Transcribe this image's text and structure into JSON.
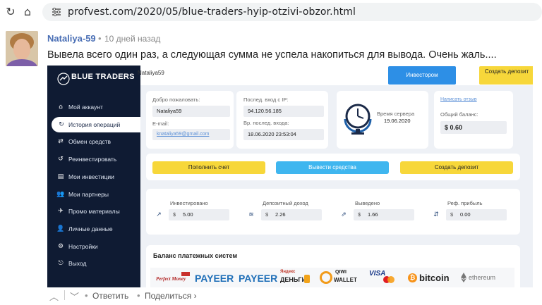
{
  "browser": {
    "url": "profvest.com/2020/05/blue-traders-hyip-otzivi-obzor.html"
  },
  "comment": {
    "author": "Nataliya-59",
    "separator": "•",
    "time": "10 дней назад",
    "text": "Вывела всего один раз, а следующая сумма не успела накопиться для вывода. Очень жаль....",
    "reply_label": "Ответить",
    "share_label": "Поделиться ›"
  },
  "screenshot": {
    "logo": "BLUE TRADERS",
    "header_user": "Nataliya59",
    "invest_button": "Инвестором",
    "create_deposit_button": "Создать депозит",
    "sidebar": [
      {
        "icon": "⌂",
        "label": "Мой аккаунт"
      },
      {
        "icon": "↻",
        "label": "История операций",
        "active": true
      },
      {
        "icon": "⇄",
        "label": "Обмен средств"
      },
      {
        "icon": "↺",
        "label": "Реинвестировать"
      },
      {
        "icon": "▤",
        "label": "Мои инвестиции"
      },
      {
        "icon": "👥",
        "label": "Мои партнеры"
      },
      {
        "icon": "✈",
        "label": "Промо материалы"
      },
      {
        "icon": "👤",
        "label": "Личные данные"
      },
      {
        "icon": "⚙",
        "label": "Настройки"
      },
      {
        "icon": "⎋",
        "label": "Выход"
      }
    ],
    "welcome": {
      "label": "Добро пожаловать:",
      "value": "Nataliya59",
      "email_label": "E-mail:",
      "email_value": "knataliya59@gmail.com"
    },
    "last_login": {
      "ip_label": "Послед. вход с IP:",
      "ip_value": "94.120.56.185",
      "time_label": "Вр. послед. входа:",
      "time_value": "18.06.2020 23:53:04"
    },
    "server_time": {
      "label": "Время сервера",
      "date": "19.06.2020"
    },
    "balance": {
      "link": "Написать отзыв",
      "label": "Общий баланс:",
      "value": "$ 0.60"
    },
    "actions": {
      "topup": "Пополнить счет",
      "withdraw": "Вывести средства",
      "create": "Создать депозит"
    },
    "stats": [
      {
        "icon": "↗",
        "label": "Инвестировано",
        "currency": "$",
        "value": "5.00"
      },
      {
        "icon": "≋",
        "label": "Депозитный доход",
        "currency": "$",
        "value": "2.26"
      },
      {
        "icon": "⇗",
        "label": "Выведено",
        "currency": "$",
        "value": "1.66"
      },
      {
        "icon": "⇵",
        "label": "Реф. прибыль",
        "currency": "$",
        "value": "0.00"
      }
    ],
    "payments": {
      "title": "Баланс платежных систем",
      "perfect_money": "Perfect Money",
      "payeer1": "PAYEER",
      "payeer2": "PAYEER",
      "yandex_top": "Яндекс",
      "yandex_bottom": "ДЕНЬГИ",
      "qiwi_top": "QIWI",
      "qiwi_bottom": "WALLET",
      "visa": "VISA",
      "bitcoin": "bitcoin",
      "ethereum": "ethereum"
    }
  },
  "colors": {
    "sidebar_bg": "#0f1b33",
    "blue_button": "#2d8fe6",
    "yellow_button": "#f7d73a",
    "light_blue_button": "#3fb6ef",
    "author_link": "#4a6fb5"
  }
}
